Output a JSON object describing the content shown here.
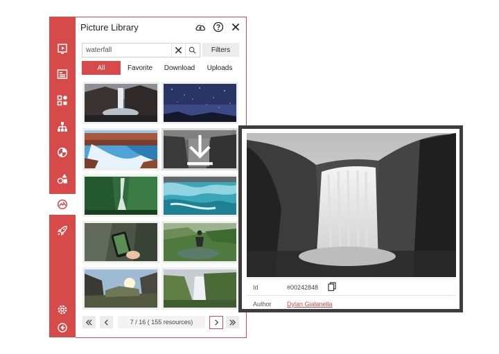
{
  "panel": {
    "title": "Picture Library"
  },
  "header_icons": [
    "cloud-upload-icon",
    "help-icon",
    "close-icon"
  ],
  "sidebar": {
    "items": [
      {
        "icon": "play-slide-icon",
        "active": false
      },
      {
        "icon": "text-layout-icon",
        "active": false
      },
      {
        "icon": "widgets-icon",
        "active": false
      },
      {
        "icon": "hierarchy-icon",
        "active": false
      },
      {
        "icon": "color-palette-icon",
        "active": false
      },
      {
        "icon": "shapes-icon",
        "active": false
      },
      {
        "icon": "picture-icon",
        "active": true
      },
      {
        "icon": "rocket-icon",
        "active": false
      }
    ],
    "bottom": [
      "settings-icon",
      "back-arrow-icon"
    ]
  },
  "search": {
    "value": "waterfall",
    "filters_label": "Filters"
  },
  "tabs": [
    {
      "label": "All",
      "active": true
    },
    {
      "label": "Favorite",
      "active": false
    },
    {
      "label": "Download",
      "active": false
    },
    {
      "label": "Uploads",
      "active": false
    }
  ],
  "thumbnails": [
    {
      "subject": "waterfall at dusk"
    },
    {
      "subject": "starry night sky"
    },
    {
      "subject": "canyon waterfall"
    },
    {
      "subject": "black and white waterfall",
      "hovered": true
    },
    {
      "subject": "forest waterfall"
    },
    {
      "subject": "turquoise river rapids"
    },
    {
      "subject": "phone photographing waterfall"
    },
    {
      "subject": "man jumping into lake"
    },
    {
      "subject": "canyon sunset"
    },
    {
      "subject": "green cliff waterfall"
    }
  ],
  "pager": {
    "info": "7  / 16 ( 155 resources)"
  },
  "preview": {
    "id_label": "Id",
    "id_value": "#00242848",
    "author_label": "Author",
    "author_value": "Dylan Gialanella"
  },
  "colors": {
    "accent": "#d64a4a",
    "popup_border": "#3d3d3d"
  }
}
